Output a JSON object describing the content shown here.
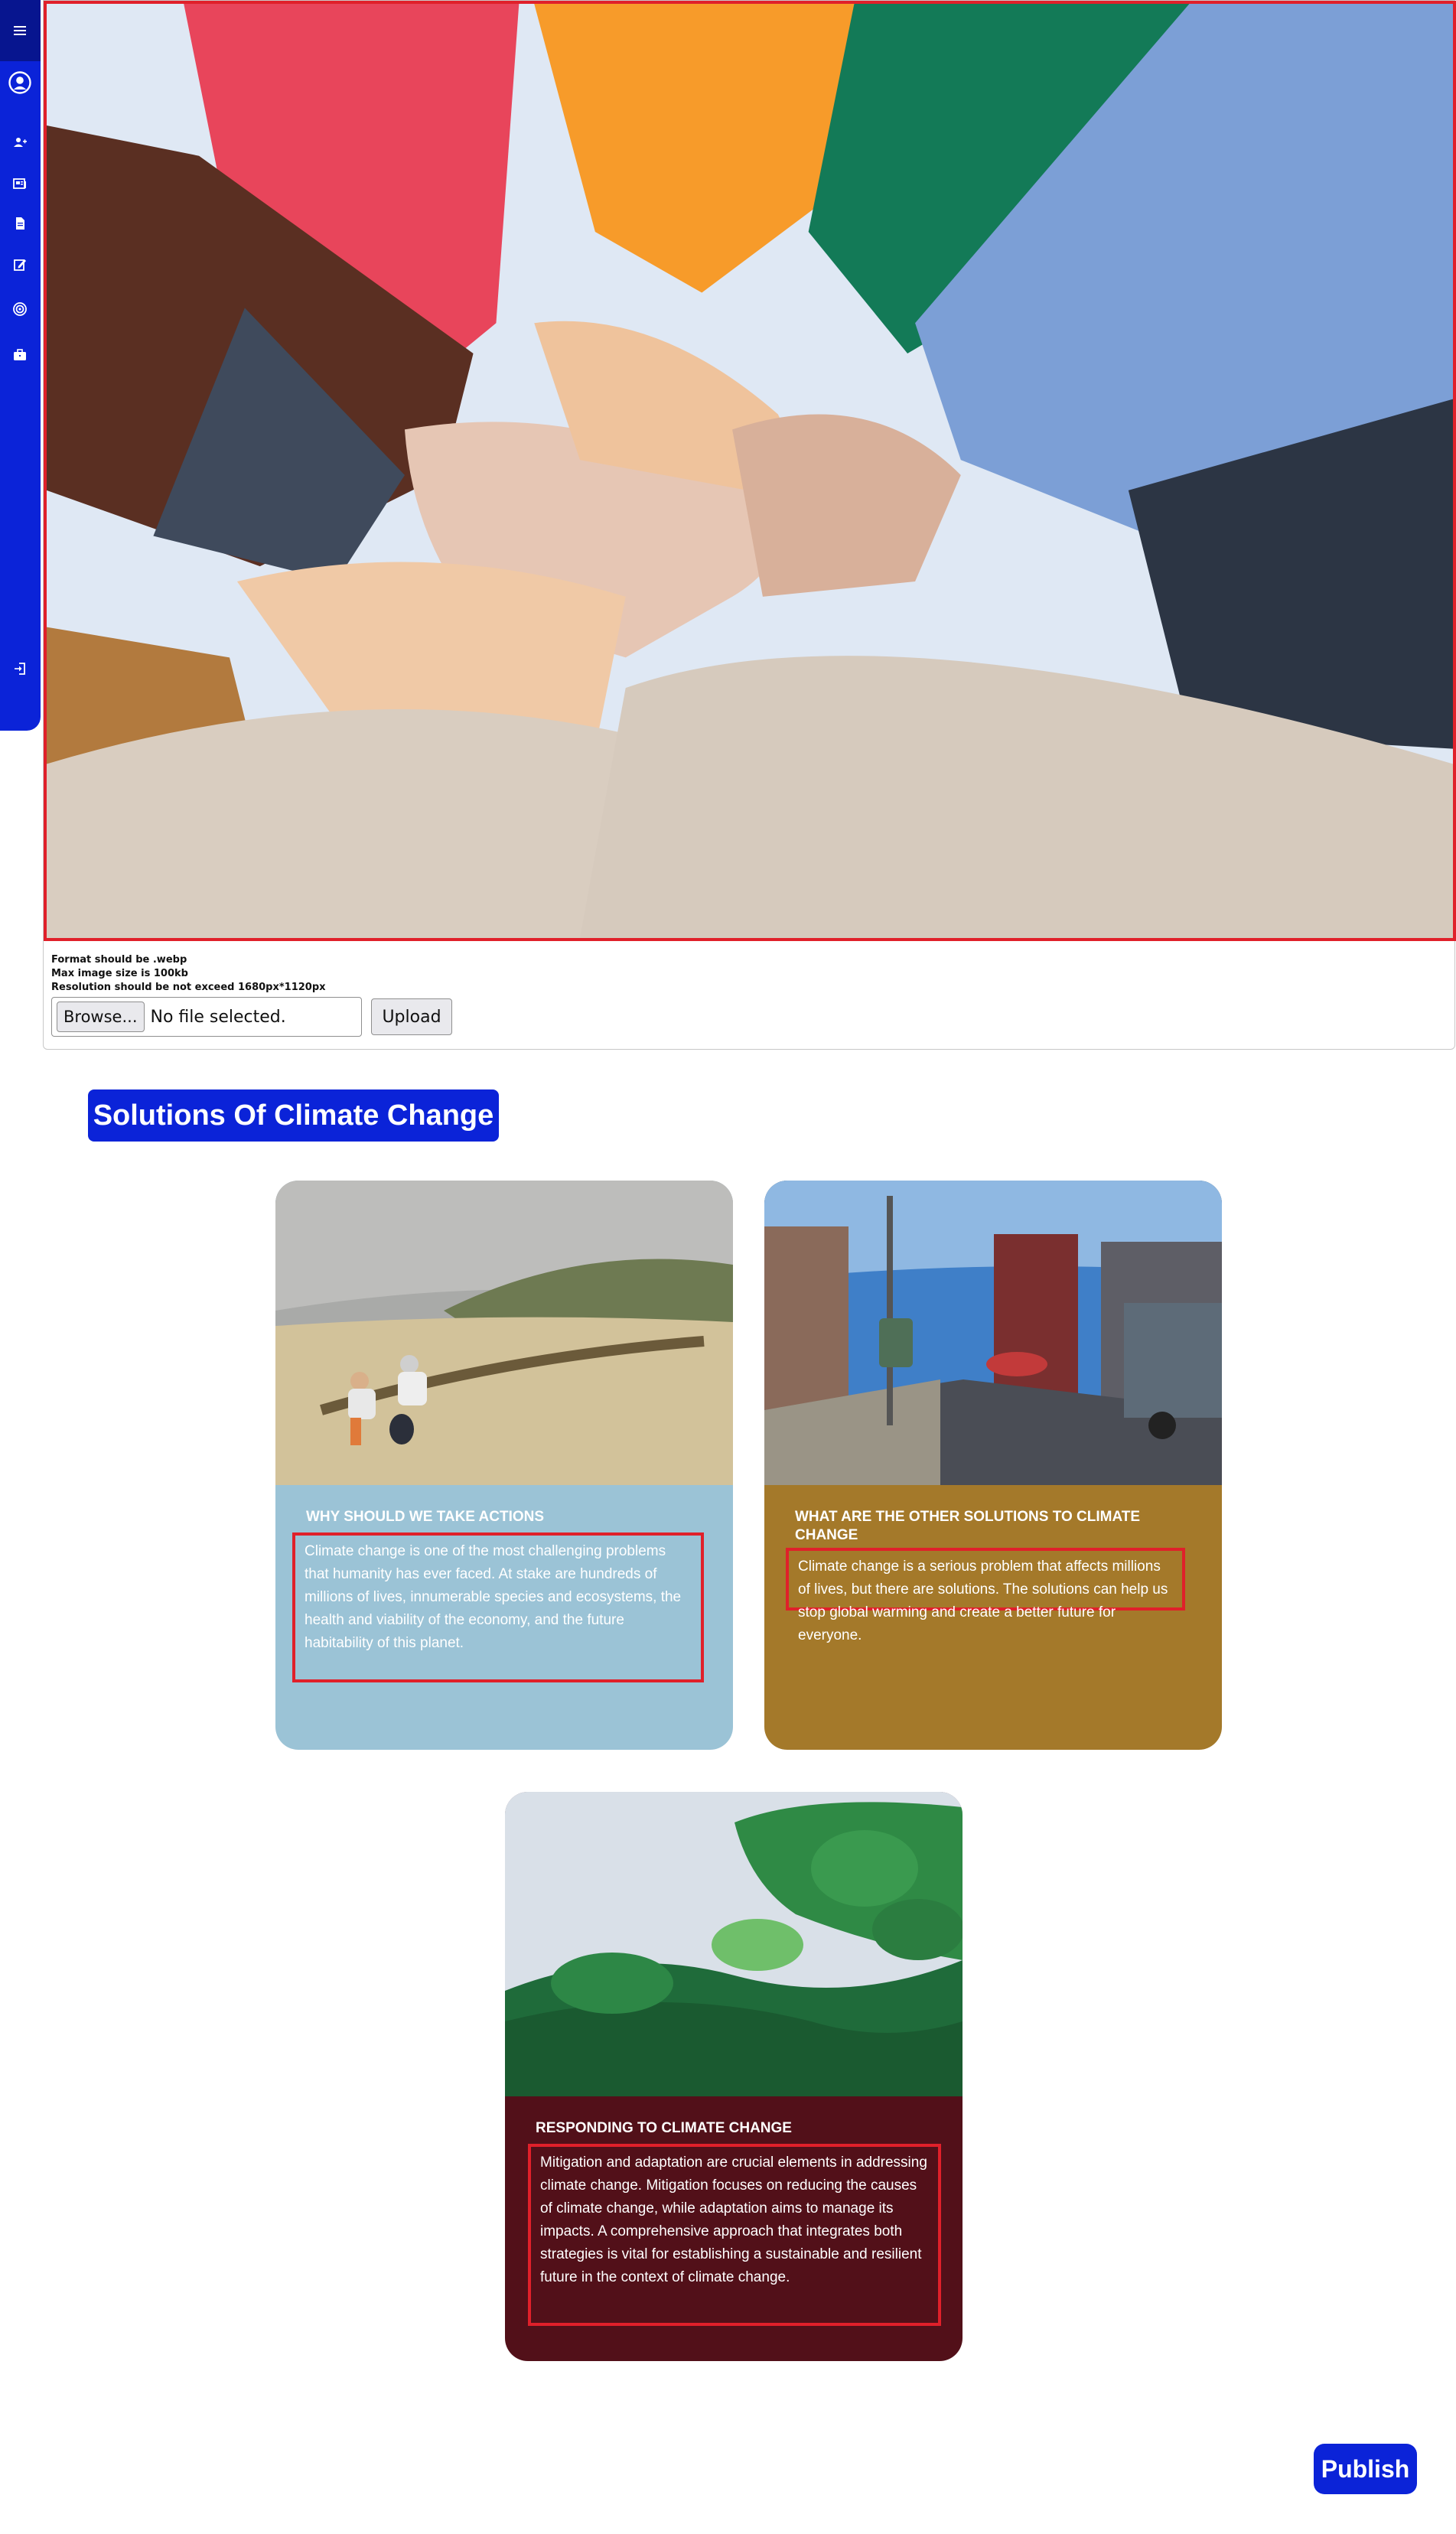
{
  "sidebar": {
    "items": [
      {
        "icon": "menu-icon"
      },
      {
        "icon": "user-circle-icon"
      },
      {
        "icon": "add-user-icon"
      },
      {
        "icon": "news-icon"
      },
      {
        "icon": "document-icon"
      },
      {
        "icon": "edit-icon"
      },
      {
        "icon": "target-icon"
      },
      {
        "icon": "briefcase-icon"
      },
      {
        "icon": "logout-icon"
      }
    ]
  },
  "upload": {
    "requirements": [
      "Format should be .webp",
      "Max image size is 100kb",
      "Resolution should be not exceed 1680px*1120px"
    ],
    "browse_label": "Browse...",
    "file_status": "No file selected.",
    "upload_label": "Upload"
  },
  "section": {
    "title": "Solutions Of Climate Change"
  },
  "cards": [
    {
      "title": "WHY SHOULD WE TAKE ACTIONS",
      "text": "Climate change is one of the most challenging problems that humanity has ever faced. At stake are hundreds of millions of lives, innumerable species and ecosystems, the health and viability of the economy, and the future habitability of this planet.",
      "color": "#9bc3d6"
    },
    {
      "title": "WHAT ARE THE OTHER SOLUTIONS TO CLIMATE CHANGE",
      "text": "Climate change is a serious problem that affects millions of lives, but there are solutions. The solutions can help us stop global warming and create a better future for everyone.",
      "color": "#a4792a"
    },
    {
      "title": "RESPONDING TO CLIMATE CHANGE",
      "text": "Mitigation and adaptation are crucial elements in addressing climate change. Mitigation focuses on reducing the causes of climate change, while adaptation aims to manage its impacts. A comprehensive approach that integrates both strategies is vital for establishing a sustainable and resilient future in the context of climate change.",
      "color": "#521019"
    }
  ],
  "publish_label": "Publish",
  "colors": {
    "accent": "#0b23d8",
    "highlight_border": "#e0202a"
  }
}
